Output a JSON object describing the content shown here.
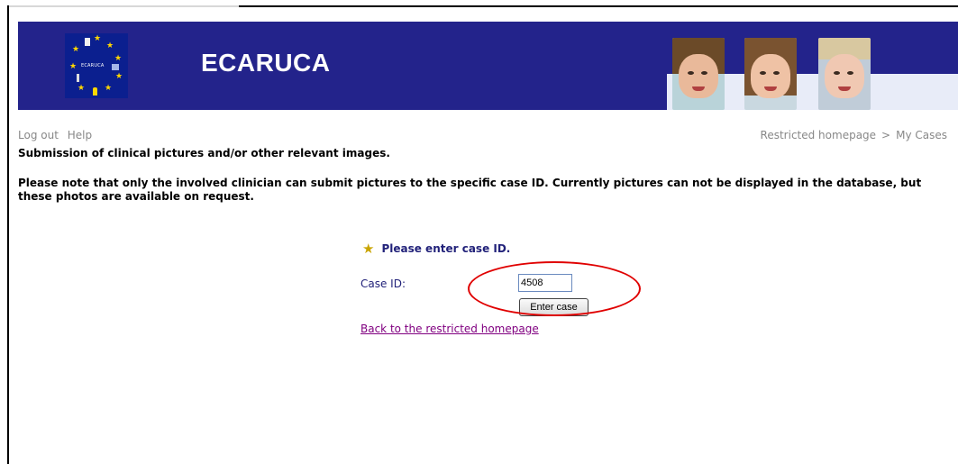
{
  "header": {
    "brand": "ECARUCA",
    "logo_text": "ECARUCA"
  },
  "nav": {
    "logout": "Log out",
    "help": "Help",
    "breadcrumb_home": "Restricted homepage",
    "breadcrumb_sep": ">",
    "breadcrumb_cases": "My Cases"
  },
  "page": {
    "title": "Submission of clinical pictures and/or other relevant images.",
    "note": "Please note that only the involved clinician can submit pictures to the specific case ID. Currently pictures can not be displayed in the database, but these photos are available on request.",
    "prompt": "Please enter case ID."
  },
  "form": {
    "case_label": "Case ID:",
    "case_value": "4508",
    "submit_label": "Enter case"
  },
  "links": {
    "back": "Back to the restricted homepage"
  },
  "colors": {
    "header_bg": "#23238b",
    "highlight": "#e00000",
    "link_visited": "#800080"
  }
}
